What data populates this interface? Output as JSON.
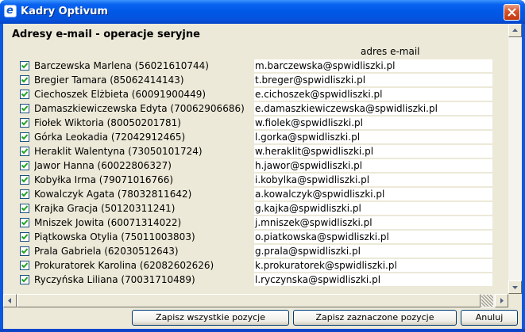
{
  "window": {
    "title": "Kadry Optivum",
    "icon": "ie-icon"
  },
  "heading": "Adresy e-mail - operacje seryjne",
  "column_header": "adres e-mail",
  "rows": [
    {
      "name": "Barczewska Marlena (56021610744)",
      "email": "m.barczewska@spwidliszki.pl",
      "checked": true
    },
    {
      "name": "Bregier Tamara (85062414143)",
      "email": "t.breger@spwidliszki.pl",
      "checked": true
    },
    {
      "name": "Ciechoszek Elżbieta (60091900449)",
      "email": "e.cichoszek@spwidliszki.pl",
      "checked": true
    },
    {
      "name": "Damaszkiewiczewska Edyta (70062906686)",
      "email": "e.damaszkiewiczewska@spwidliszki.pl",
      "checked": true
    },
    {
      "name": "Fiołek Wiktoria (80050201781)",
      "email": "w.fiolek@spwidliszki.pl",
      "checked": true
    },
    {
      "name": "Górka Leokadia (72042912465)",
      "email": "l.gorka@spwidliszki.pl",
      "checked": true
    },
    {
      "name": "Heraklit Walentyna (73050101724)",
      "email": "w.heraklit@spwidliszki.pl",
      "checked": true
    },
    {
      "name": "Jawor Hanna (60022806327)",
      "email": "h.jawor@spwidliszki.pl",
      "checked": true
    },
    {
      "name": "Kobyłka Irma (79071016766)",
      "email": "i.kobylka@spwidliszki.pl",
      "checked": true
    },
    {
      "name": "Kowalczyk Agata (78032811642)",
      "email": "a.kowalczyk@spwidliszki.pl",
      "checked": true
    },
    {
      "name": "Krajka Gracja (50120311241)",
      "email": "g.kajka@spwidliszki.pl",
      "checked": true
    },
    {
      "name": "Mniszek Jowita (60071314022)",
      "email": "j.mniszek@spwidliszki.pl",
      "checked": true
    },
    {
      "name": "Piątkowska Otylia (75011003803)",
      "email": "o.piatkowska@spwidliszki.pl",
      "checked": true
    },
    {
      "name": "Prala Gabriela (62030512643)",
      "email": "g.prala@spwidliszki.pl",
      "checked": true
    },
    {
      "name": "Prokuratorek Karolina (62082602626)",
      "email": "k.prokuratorek@spwidliszki.pl",
      "checked": true
    },
    {
      "name": "Ryczyńska Liliana (70031710489)",
      "email": "l.ryczynska@spwidliszki.pl",
      "checked": true
    }
  ],
  "buttons": {
    "save_all": "Zapisz wszystkie pozycje",
    "save_selected": "Zapisz zaznaczone pozycje",
    "cancel": "Anuluj"
  },
  "colors": {
    "titlebar": "#0058e6",
    "client_bg": "#ece9d8",
    "check": "#21a121",
    "close_btn": "#d8552e"
  }
}
